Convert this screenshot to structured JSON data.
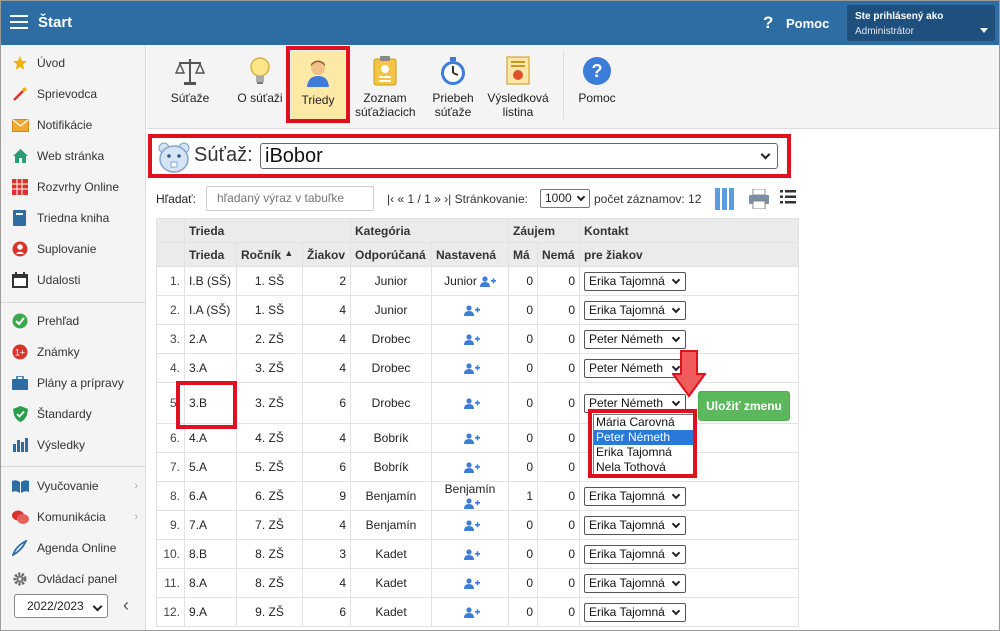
{
  "topbar": {
    "title": "Štart",
    "help_label": "Pomoc",
    "help_icon": "?",
    "user_line1": "Ste prihlásený ako",
    "user_line2": "Administrátor"
  },
  "sidebar": {
    "items": [
      {
        "label": "Úvod",
        "icon": "star-icon"
      },
      {
        "label": "Sprievodca",
        "icon": "magic-wand-icon"
      },
      {
        "label": "Notifikácie",
        "icon": "envelope-icon"
      },
      {
        "label": "Web stránka",
        "icon": "home-icon"
      },
      {
        "label": "Rozvrhy Online",
        "icon": "calendar-grid-icon"
      },
      {
        "label": "Triedna kniha",
        "icon": "book-icon"
      },
      {
        "label": "Suplovanie",
        "icon": "substitute-person-icon"
      },
      {
        "label": "Udalosti",
        "icon": "calendar-icon"
      },
      {
        "label": "Prehľad",
        "icon": "check-circle-icon"
      },
      {
        "label": "Známky",
        "icon": "grade-icon"
      },
      {
        "label": "Plány a prípravy",
        "icon": "briefcase-icon"
      },
      {
        "label": "Štandardy",
        "icon": "shield-check-icon"
      },
      {
        "label": "Výsledky",
        "icon": "bar-chart-icon"
      },
      {
        "label": "Vyučovanie",
        "icon": "open-book-icon"
      },
      {
        "label": "Komunikácia",
        "icon": "chat-icon"
      },
      {
        "label": "Agenda Online",
        "icon": "pen-icon"
      },
      {
        "label": "Ovládací panel",
        "icon": "gear-icon"
      }
    ],
    "year": "2022/2023",
    "collapse_glyph": "‹"
  },
  "toolbar": {
    "buttons": [
      {
        "label": "Súťaže",
        "icon": "scales-icon"
      },
      {
        "label": "O súťaži",
        "icon": "lightbulb-icon"
      },
      {
        "label": "Triedy",
        "icon": "student-icon"
      },
      {
        "label": "Zoznam súťažiacich",
        "icon": "id-card-icon"
      },
      {
        "label": "Priebeh súťaže",
        "icon": "stopwatch-icon"
      },
      {
        "label": "Výsledková listina",
        "icon": "certificate-icon"
      },
      {
        "label": "Pomoc",
        "icon": "help-circle-icon"
      }
    ]
  },
  "contest": {
    "label": "Súťaž:",
    "selected": "iBobor"
  },
  "filter": {
    "search_label": "Hľadať:",
    "search_placeholder": "hľadaný výraz v tabuľke",
    "pagination": "|‹ « 1 / 1 » ›|  Stránkovanie:",
    "page_size": "1000",
    "record_count": "počet záznamov: 12"
  },
  "table": {
    "group_headers": [
      "Trieda",
      "Kategória",
      "Záujem",
      "Kontakt"
    ],
    "col_headers": [
      "Trieda",
      "Ročník",
      "Žiakov",
      "Odporúčaná",
      "Nastavená",
      "Má",
      "Nemá",
      "pre žiakov"
    ],
    "sort_indicator": "▲",
    "rows": [
      {
        "n": "1.",
        "trieda": "I.B (SŠ)",
        "rocnik": "1. SŠ",
        "ziakov": "2",
        "odp": "Junior",
        "nast": "Junior",
        "ma": "0",
        "nema": "0",
        "kontakt": "Erika Tajomná"
      },
      {
        "n": "2.",
        "trieda": "I.A (SŠ)",
        "rocnik": "1. SŠ",
        "ziakov": "4",
        "odp": "Junior",
        "nast": "",
        "ma": "0",
        "nema": "0",
        "kontakt": "Erika Tajomná"
      },
      {
        "n": "3.",
        "trieda": "2.A",
        "rocnik": "2. ZŠ",
        "ziakov": "4",
        "odp": "Drobec",
        "nast": "",
        "ma": "0",
        "nema": "0",
        "kontakt": "Peter Németh"
      },
      {
        "n": "4.",
        "trieda": "3.A",
        "rocnik": "3. ZŠ",
        "ziakov": "4",
        "odp": "Drobec",
        "nast": "",
        "ma": "0",
        "nema": "0",
        "kontakt": "Peter Németh"
      },
      {
        "n": "5.",
        "trieda": "3.B",
        "rocnik": "3. ZŠ",
        "ziakov": "6",
        "odp": "Drobec",
        "nast": "",
        "ma": "0",
        "nema": "0",
        "kontakt": "Peter Németh"
      },
      {
        "n": "6.",
        "trieda": "4.A",
        "rocnik": "4. ZŠ",
        "ziakov": "4",
        "odp": "Bobrík",
        "nast": "",
        "ma": "0",
        "nema": "0",
        "kontakt": ""
      },
      {
        "n": "7.",
        "trieda": "5.A",
        "rocnik": "5. ZŠ",
        "ziakov": "6",
        "odp": "Bobrík",
        "nast": "",
        "ma": "0",
        "nema": "0",
        "kontakt": ""
      },
      {
        "n": "8.",
        "trieda": "6.A",
        "rocnik": "6. ZŠ",
        "ziakov": "9",
        "odp": "Benjamín",
        "nast": "Benjamín",
        "ma": "1",
        "nema": "0",
        "kontakt": "Erika Tajomná"
      },
      {
        "n": "9.",
        "trieda": "7.A",
        "rocnik": "7. ZŠ",
        "ziakov": "4",
        "odp": "Benjamín",
        "nast": "",
        "ma": "0",
        "nema": "0",
        "kontakt": "Erika Tajomná"
      },
      {
        "n": "10.",
        "trieda": "8.B",
        "rocnik": "8. ZŠ",
        "ziakov": "3",
        "odp": "Kadet",
        "nast": "",
        "ma": "0",
        "nema": "0",
        "kontakt": "Erika Tajomná"
      },
      {
        "n": "11.",
        "trieda": "8.A",
        "rocnik": "8. ZŠ",
        "ziakov": "4",
        "odp": "Kadet",
        "nast": "",
        "ma": "0",
        "nema": "0",
        "kontakt": "Erika Tajomná"
      },
      {
        "n": "12.",
        "trieda": "9.A",
        "rocnik": "9. ZŠ",
        "ziakov": "6",
        "odp": "Kadet",
        "nast": "",
        "ma": "0",
        "nema": "0",
        "kontakt": "Erika Tajomná"
      }
    ]
  },
  "save_button": "Uložiť zmenu",
  "dropdown_options": [
    "Mária Carovná",
    "Peter Németh",
    "Erika Tajomná",
    "Nela Tothová"
  ],
  "dropdown_selected": "Peter Németh",
  "colors": {
    "topbar": "#2e6da4",
    "highlight": "#e0101e",
    "save": "#5cb85c",
    "active_tab": "#fde9a6",
    "selected_option": "#2a79d8"
  }
}
